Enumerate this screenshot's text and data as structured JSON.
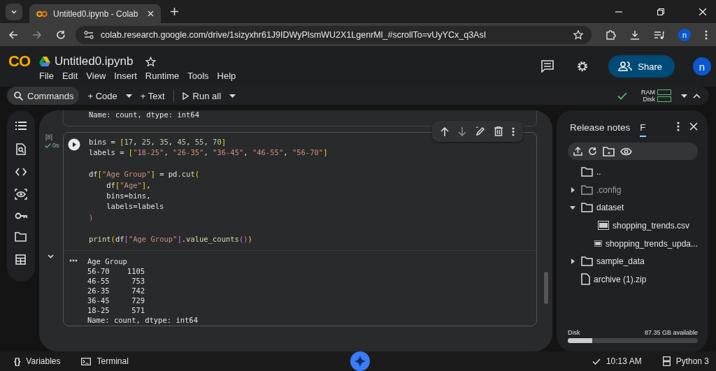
{
  "browser": {
    "tab_title": "Untitled0.ipynb - Colab",
    "url": "colab.research.google.com/drive/1sizyxhr61J9IDWyPlsmWU2X1LgenrMl_#scrollTo=vUyYCx_q3AsI",
    "avatar": "n"
  },
  "app": {
    "logo": "CO",
    "title": "Untitled0.ipynb",
    "menu": [
      "File",
      "Edit",
      "View",
      "Insert",
      "Runtime",
      "Tools",
      "Help"
    ],
    "share": "Share",
    "avatar": "n"
  },
  "toolbar": {
    "commands": "Commands",
    "code": "+ Code",
    "text": "+ Text",
    "run_all": "Run all",
    "ram": "RAM",
    "disk": "Disk"
  },
  "prev_output": "Name: count, dtype: int64",
  "cell": {
    "exec_count": "[8]",
    "exec_time": "0s",
    "code_lines": [
      {
        "text": "bins = [17, 25, 35, 45, 55, 70]",
        "gap_before": false
      },
      {
        "text": "labels = [\"18-25\", \"26-35\", \"36-45\", \"46-55\", \"56-70\"]",
        "gap_before": false
      },
      {
        "text": "df[\"Age Group\"] = pd.cut(",
        "gap_before": true
      },
      {
        "text": "    df[\"Age\"],",
        "gap_before": false
      },
      {
        "text": "    bins=bins,",
        "gap_before": false
      },
      {
        "text": "    labels=labels",
        "gap_before": false
      },
      {
        "text": ")",
        "gap_before": false
      },
      {
        "text": "print(df[\"Age Group\"].value_counts())",
        "gap_before": true
      }
    ],
    "output_lines": [
      "Age Group",
      "56-70    1105",
      "46-55     753",
      "26-35     742",
      "36-45     729",
      "18-25     571",
      "Name: count, dtype: int64"
    ]
  },
  "files": {
    "tabs": [
      {
        "label": "Release notes",
        "selected": false
      },
      {
        "label": "F",
        "selected": true
      }
    ],
    "tree": [
      {
        "name": "..",
        "kind": "folder",
        "dim": false
      },
      {
        "name": ".config",
        "kind": "folder",
        "expanded": false,
        "dim": true
      },
      {
        "name": "dataset",
        "kind": "folder",
        "expanded": true,
        "dim": false,
        "children": [
          {
            "name": "shopping_trends.csv",
            "kind": "csv",
            "dim": false
          },
          {
            "name": "shopping_trends_upda...",
            "kind": "csv",
            "dim": false
          }
        ]
      },
      {
        "name": "sample_data",
        "kind": "folder",
        "expanded": false,
        "dim": false
      },
      {
        "name": "archive (1).zip",
        "kind": "file",
        "dim": false
      }
    ],
    "disk_label": "Disk",
    "disk_available": "87.35 GB available",
    "disk_meter": {
      "level": 0.19
    }
  },
  "status": {
    "variables_icon": "{}",
    "variables": "Variables",
    "terminal": "Terminal",
    "time": "10:13 AM",
    "runtime": "Python 3"
  }
}
